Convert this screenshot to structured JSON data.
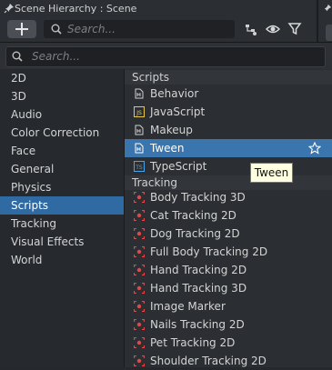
{
  "panel": {
    "title": "Scene Hierarchy : Scene",
    "search_placeholder": "Search..."
  },
  "dropdown": {
    "search_placeholder": "Search...",
    "categories": [
      "2D",
      "3D",
      "Audio",
      "Color Correction",
      "Face",
      "General",
      "Physics",
      "Scripts",
      "Tracking",
      "Visual Effects",
      "World"
    ],
    "selected_category": "Scripts",
    "sections": [
      {
        "title": "Scripts",
        "items": [
          "Behavior",
          "JavaScript",
          "Makeup",
          "Tween",
          "TypeScript"
        ]
      },
      {
        "title": "Tracking",
        "items": [
          "Body Tracking 3D",
          "Cat Tracking 2D",
          "Dog Tracking 2D",
          "Full Body Tracking 2D",
          "Hand Tracking 2D",
          "Hand Tracking 3D",
          "Image Marker",
          "Nails Tracking 2D",
          "Pet Tracking 2D",
          "Shoulder Tracking 2D"
        ]
      }
    ],
    "selected_item": "Tween",
    "tooltip": "Tween"
  },
  "colors": {
    "selection": "#3a75ae",
    "category_selection": "#2f6aa3",
    "tracking_icon": "#e04848",
    "js_icon": "#e6c84a",
    "ts_icon": "#4aa3e6"
  }
}
